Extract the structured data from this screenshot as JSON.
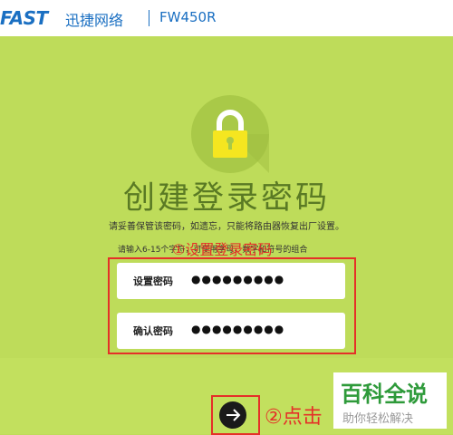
{
  "header": {
    "logo": "FAST",
    "brand_cn": "迅捷网络",
    "model": "FW450R"
  },
  "page": {
    "title": "创建登录密码",
    "hint": "请妥善保管该密码，如遗忘，只能将路由器恢复出厂设置。",
    "rules": "请输入6-15个字符，可使用字母、数字和符号的组合"
  },
  "form": {
    "password_label": "设置密码",
    "password_value": "●●●●●●●●●",
    "confirm_label": "确认密码",
    "confirm_value": "●●●●●●●●●"
  },
  "annotations": {
    "step1": "①设置登录密码",
    "step2": "②点击"
  },
  "watermark": {
    "main": "百科全说",
    "sub": "助你轻松解决"
  },
  "icons": {
    "lock": "lock-icon",
    "next": "arrow-right-icon"
  },
  "colors": {
    "background": "#bedc5a",
    "brand": "#1a6fc2",
    "title": "#5a7a24",
    "annotation": "#e53028",
    "lock": "#f5e620"
  }
}
